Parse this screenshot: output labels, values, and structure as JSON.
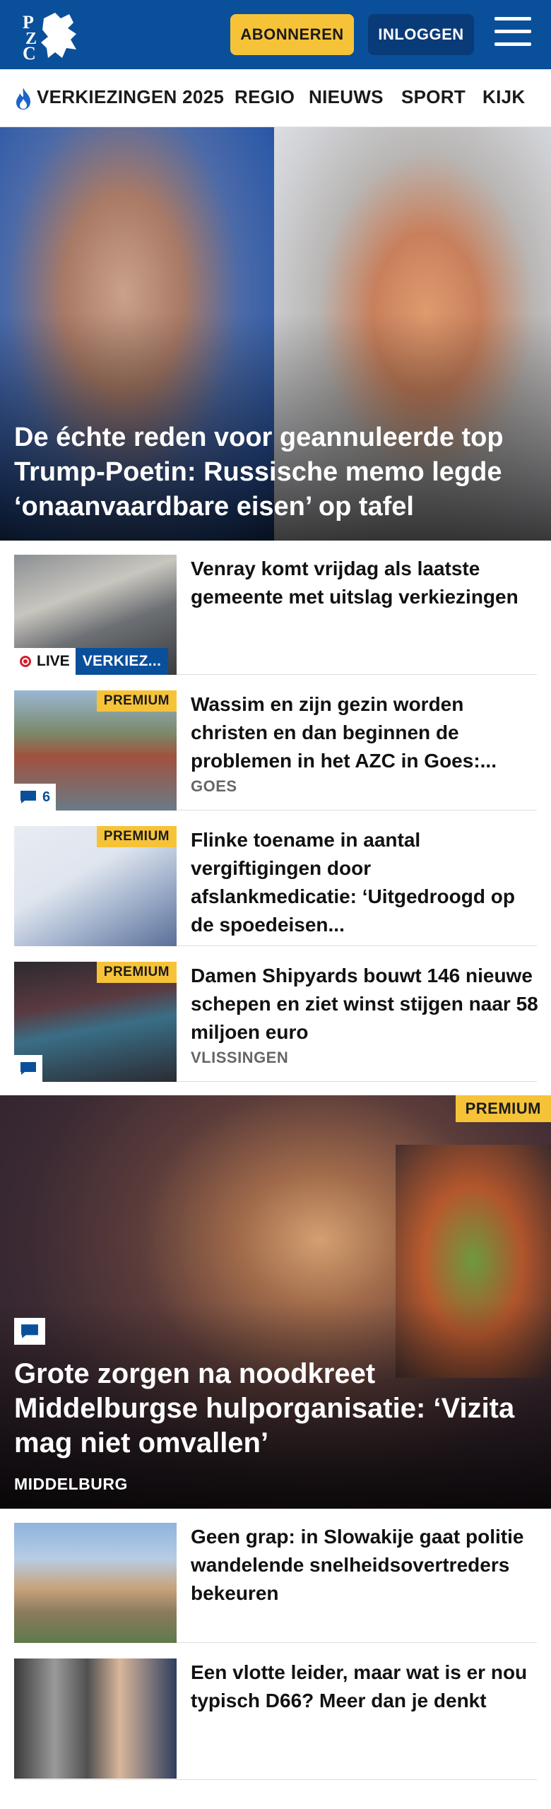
{
  "header": {
    "logo_text": "PZC",
    "subscribe_label": "ABONNEREN",
    "login_label": "INLOGGEN",
    "colors": {
      "brand": "#0a4f9a",
      "accent": "#f6c338"
    }
  },
  "nav": {
    "items": [
      {
        "label": "VERKIEZINGEN 2025",
        "icon": "flame-icon"
      },
      {
        "label": "REGIO"
      },
      {
        "label": "NIEUWS"
      },
      {
        "label": "SPORT"
      },
      {
        "label": "KIJK"
      }
    ]
  },
  "hero": {
    "title": "De échte reden voor geannuleerde top Trump-Poetin: Russische memo legde ‘onaanvaardbare eisen’ op tafel"
  },
  "articles": [
    {
      "title": "Venray komt vrijdag als laatste gemeente met uitslag verkiezingen",
      "live_label": "LIVE",
      "topic_label": "VERKIEZ..."
    },
    {
      "title": "Wassim en zijn gezin worden christen en dan beginnen de problemen in het AZC in Goes:...",
      "premium_label": "PREMIUM",
      "comment_count": "6",
      "region": "GOES"
    },
    {
      "title": "Flinke toename in aantal vergiftigingen door afslankmedicatie: ‘Uitgedroogd op de spoedeisen...",
      "premium_label": "PREMIUM"
    },
    {
      "title": "Damen Shipyards bouwt 146 nieuwe schepen en ziet winst stijgen naar 58 miljoen euro",
      "premium_label": "PREMIUM",
      "region": "VLISSINGEN"
    }
  ],
  "feature": {
    "premium_label": "PREMIUM",
    "title": "Grote zorgen na noodkreet Middelburgse hulporganisatie: ‘Vizita mag niet omvallen’",
    "region": "MIDDELBURG"
  },
  "articles_bottom": [
    {
      "title": "Geen grap: in Slowakije gaat politie wandelende snelheidsovertreders bekeuren"
    },
    {
      "title": "Een vlotte leider, maar wat is er nou typisch D66? Meer dan je denkt"
    }
  ]
}
